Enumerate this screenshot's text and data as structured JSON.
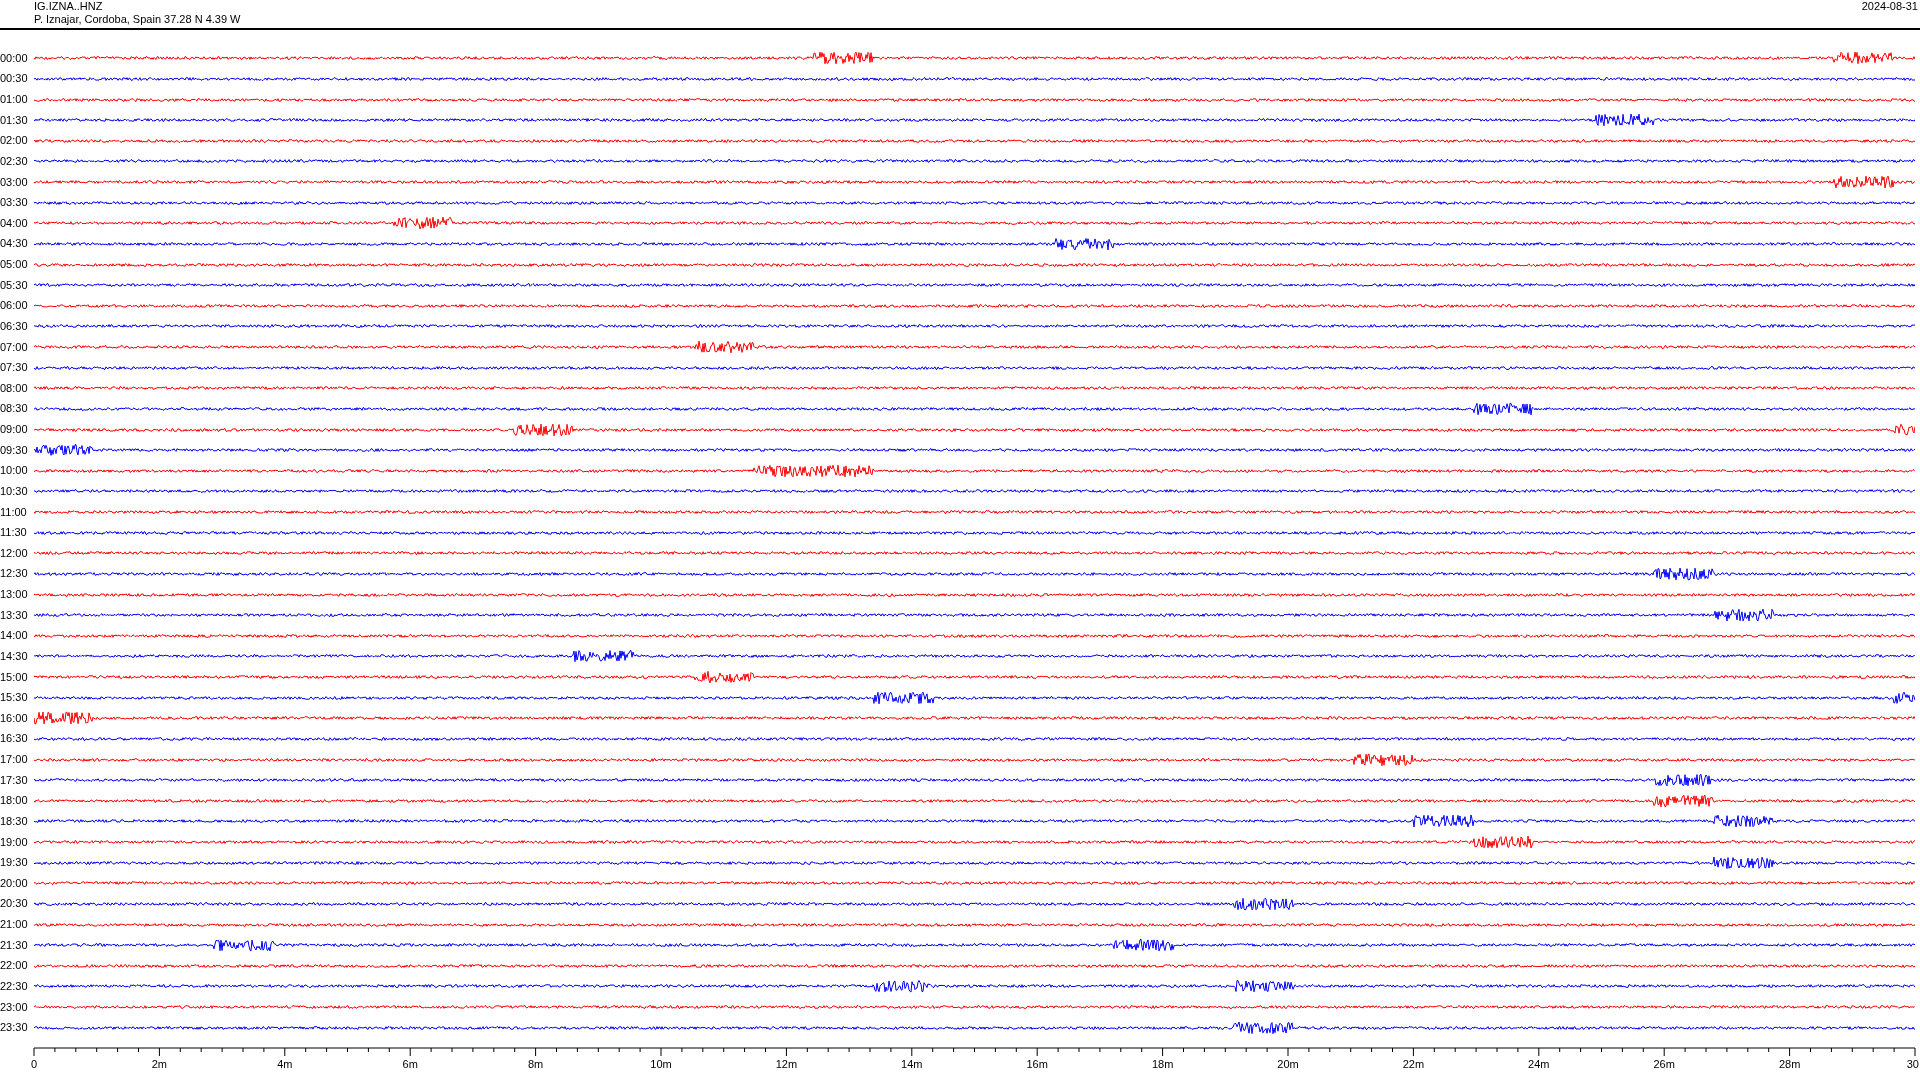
{
  "header": {
    "station": "IG.IZNA..HNZ",
    "location": "P. Iznajar, Cordoba, Spain  37.28 N 4.39 W",
    "date": "2024-08-31"
  },
  "traces": [
    {
      "time": "00:00",
      "color": "#ff0000"
    },
    {
      "time": "00:30",
      "color": "#0000ff"
    },
    {
      "time": "01:00",
      "color": "#ff0000"
    },
    {
      "time": "01:30",
      "color": "#0000ff"
    },
    {
      "time": "02:00",
      "color": "#ff0000"
    },
    {
      "time": "02:30",
      "color": "#0000ff"
    },
    {
      "time": "03:00",
      "color": "#ff0000"
    },
    {
      "time": "03:30",
      "color": "#0000ff"
    },
    {
      "time": "04:00",
      "color": "#ff0000"
    },
    {
      "time": "04:30",
      "color": "#0000ff"
    },
    {
      "time": "05:00",
      "color": "#ff0000"
    },
    {
      "time": "05:30",
      "color": "#0000ff"
    },
    {
      "time": "06:00",
      "color": "#ff0000"
    },
    {
      "time": "06:30",
      "color": "#0000ff"
    },
    {
      "time": "07:00",
      "color": "#ff0000"
    },
    {
      "time": "07:30",
      "color": "#0000ff"
    },
    {
      "time": "08:00",
      "color": "#ff0000"
    },
    {
      "time": "08:30",
      "color": "#0000ff"
    },
    {
      "time": "09:00",
      "color": "#ff0000"
    },
    {
      "time": "09:30",
      "color": "#0000ff"
    },
    {
      "time": "10:00",
      "color": "#ff0000"
    },
    {
      "time": "10:30",
      "color": "#0000ff"
    },
    {
      "time": "11:00",
      "color": "#ff0000"
    },
    {
      "time": "11:30",
      "color": "#0000ff"
    },
    {
      "time": "12:00",
      "color": "#ff0000"
    },
    {
      "time": "12:30",
      "color": "#0000ff"
    },
    {
      "time": "13:00",
      "color": "#ff0000"
    },
    {
      "time": "13:30",
      "color": "#0000ff"
    },
    {
      "time": "14:00",
      "color": "#ff0000"
    },
    {
      "time": "14:30",
      "color": "#0000ff"
    },
    {
      "time": "15:00",
      "color": "#ff0000"
    },
    {
      "time": "15:30",
      "color": "#0000ff"
    },
    {
      "time": "16:00",
      "color": "#ff0000"
    },
    {
      "time": "16:30",
      "color": "#0000ff"
    },
    {
      "time": "17:00",
      "color": "#ff0000"
    },
    {
      "time": "17:30",
      "color": "#0000ff"
    },
    {
      "time": "18:00",
      "color": "#ff0000"
    },
    {
      "time": "18:30",
      "color": "#0000ff"
    },
    {
      "time": "19:00",
      "color": "#ff0000"
    },
    {
      "time": "19:30",
      "color": "#0000ff"
    },
    {
      "time": "20:00",
      "color": "#ff0000"
    },
    {
      "time": "20:30",
      "color": "#0000ff"
    },
    {
      "time": "21:00",
      "color": "#ff0000"
    },
    {
      "time": "21:30",
      "color": "#0000ff"
    },
    {
      "time": "22:00",
      "color": "#ff0000"
    },
    {
      "time": "22:30",
      "color": "#0000ff"
    },
    {
      "time": "23:00",
      "color": "#ff0000"
    },
    {
      "time": "23:30",
      "color": "#0000ff"
    }
  ],
  "x_axis": {
    "labels": [
      "0",
      "2m",
      "4m",
      "6m",
      "8m",
      "10m",
      "12m",
      "14m",
      "16m",
      "18m",
      "20m",
      "22m",
      "24m",
      "26m",
      "28m",
      "30"
    ]
  }
}
